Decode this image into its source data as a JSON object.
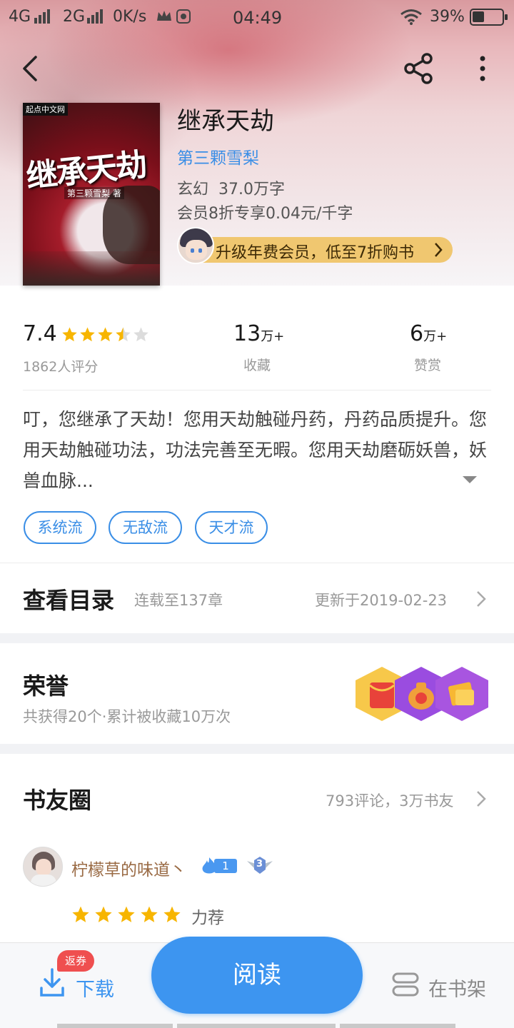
{
  "status_bar": {
    "net1": "4G",
    "net2": "2G",
    "speed": "0K/s",
    "time": "04:49",
    "battery": "39%",
    "battery_level": 0.39
  },
  "book": {
    "title": "继承天劫",
    "author": "第三颗雪梨",
    "genre_words": "玄幻  37.0万字",
    "price": "会员8折专享0.04元/千字",
    "vip_banner": "升级年费会员，低至7折购书",
    "cover": {
      "publisher": "起点中文网",
      "title": "继承天劫",
      "author_line": "第三颗雪梨 著"
    }
  },
  "stats": {
    "rating": "7.4",
    "rating_stars": 3.5,
    "rating_count": "1862人评分",
    "favorites_num": "13",
    "favorites_unit": "万+",
    "favorites_label": "收藏",
    "tips_num": "6",
    "tips_unit": "万+",
    "tips_label": "赞赏"
  },
  "description": "叮，您继承了天劫！您用天劫触碰丹药，丹药品质提升。您用天劫触碰功法，功法完善至无暇。您用天劫磨砺妖兽，妖兽血脉...",
  "tags": [
    "系统流",
    "无敌流",
    "天才流"
  ],
  "catalog": {
    "title": "查看目录",
    "progress": "连载至137章",
    "updated": "更新于2019-02-23"
  },
  "honor": {
    "title": "荣誉",
    "summary": "共获得20个·累计被收藏10万次"
  },
  "circle": {
    "title": "书友圈",
    "summary": "793评论，3万书友",
    "post": {
      "user": "柠檬草的味道丶",
      "fire_level": "1",
      "badge_level": "3",
      "stars": 5,
      "stars_label": "力荐"
    }
  },
  "bottom_bar": {
    "coupon": "返券",
    "download": "下载",
    "read": "阅读",
    "shelf": "在书架"
  },
  "colors": {
    "accent": "#3d95f0",
    "star": "#f7b500",
    "vip": "#f0c770",
    "coupon": "#ef4f4f"
  }
}
